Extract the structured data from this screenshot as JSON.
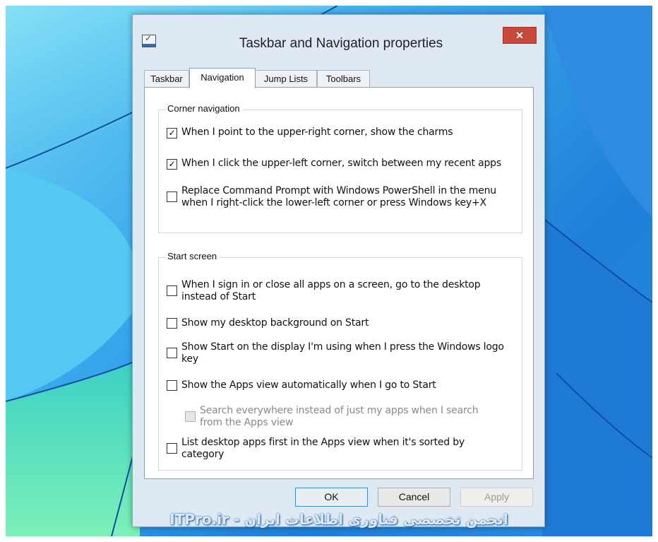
{
  "window": {
    "title": "Taskbar and Navigation properties",
    "close_label": "✕"
  },
  "tabs": [
    {
      "label": "Taskbar",
      "active": false
    },
    {
      "label": "Navigation",
      "active": true
    },
    {
      "label": "Jump Lists",
      "active": false
    },
    {
      "label": "Toolbars",
      "active": false
    }
  ],
  "corner_navigation": {
    "label": "Corner navigation",
    "options": [
      {
        "text": "When I point to the upper-right corner, show the charms",
        "checked": true
      },
      {
        "text": "When I click the upper-left corner, switch between my recent apps",
        "checked": true
      },
      {
        "text_line1": "Replace Command Prompt with Windows PowerShell in the menu",
        "text_line2": "when I right-click the lower-left corner or press Windows key+X",
        "checked": false
      }
    ]
  },
  "start_screen": {
    "label": "Start screen",
    "options": [
      {
        "text_line1": "When I sign in or close all apps on a screen, go to the desktop",
        "text_line2": "instead of Start",
        "checked": false
      },
      {
        "text": "Show my desktop background on Start",
        "checked": false
      },
      {
        "text_line1": "Show Start on the display I'm using when I press the Windows logo",
        "text_line2": "key",
        "checked": false
      },
      {
        "text": "Show the Apps view automatically when I go to Start",
        "checked": false
      },
      {
        "text_line1": "Search everywhere instead of just my apps when I search",
        "text_line2": "from the Apps view",
        "checked": false,
        "disabled": true
      },
      {
        "text_line1": "List desktop apps first in the Apps view when it's sorted by",
        "text_line2": "category",
        "checked": false
      }
    ]
  },
  "buttons": {
    "ok": "OK",
    "cancel": "Cancel",
    "apply": "Apply"
  },
  "watermark": "ITPro.ir - انجمن تخصصی فناوری اطلاعات ایران",
  "colors": {
    "desktop_accent": "#1e7fd8",
    "close_button": "#c9483c",
    "default_button_border": "#3c8bd9"
  }
}
